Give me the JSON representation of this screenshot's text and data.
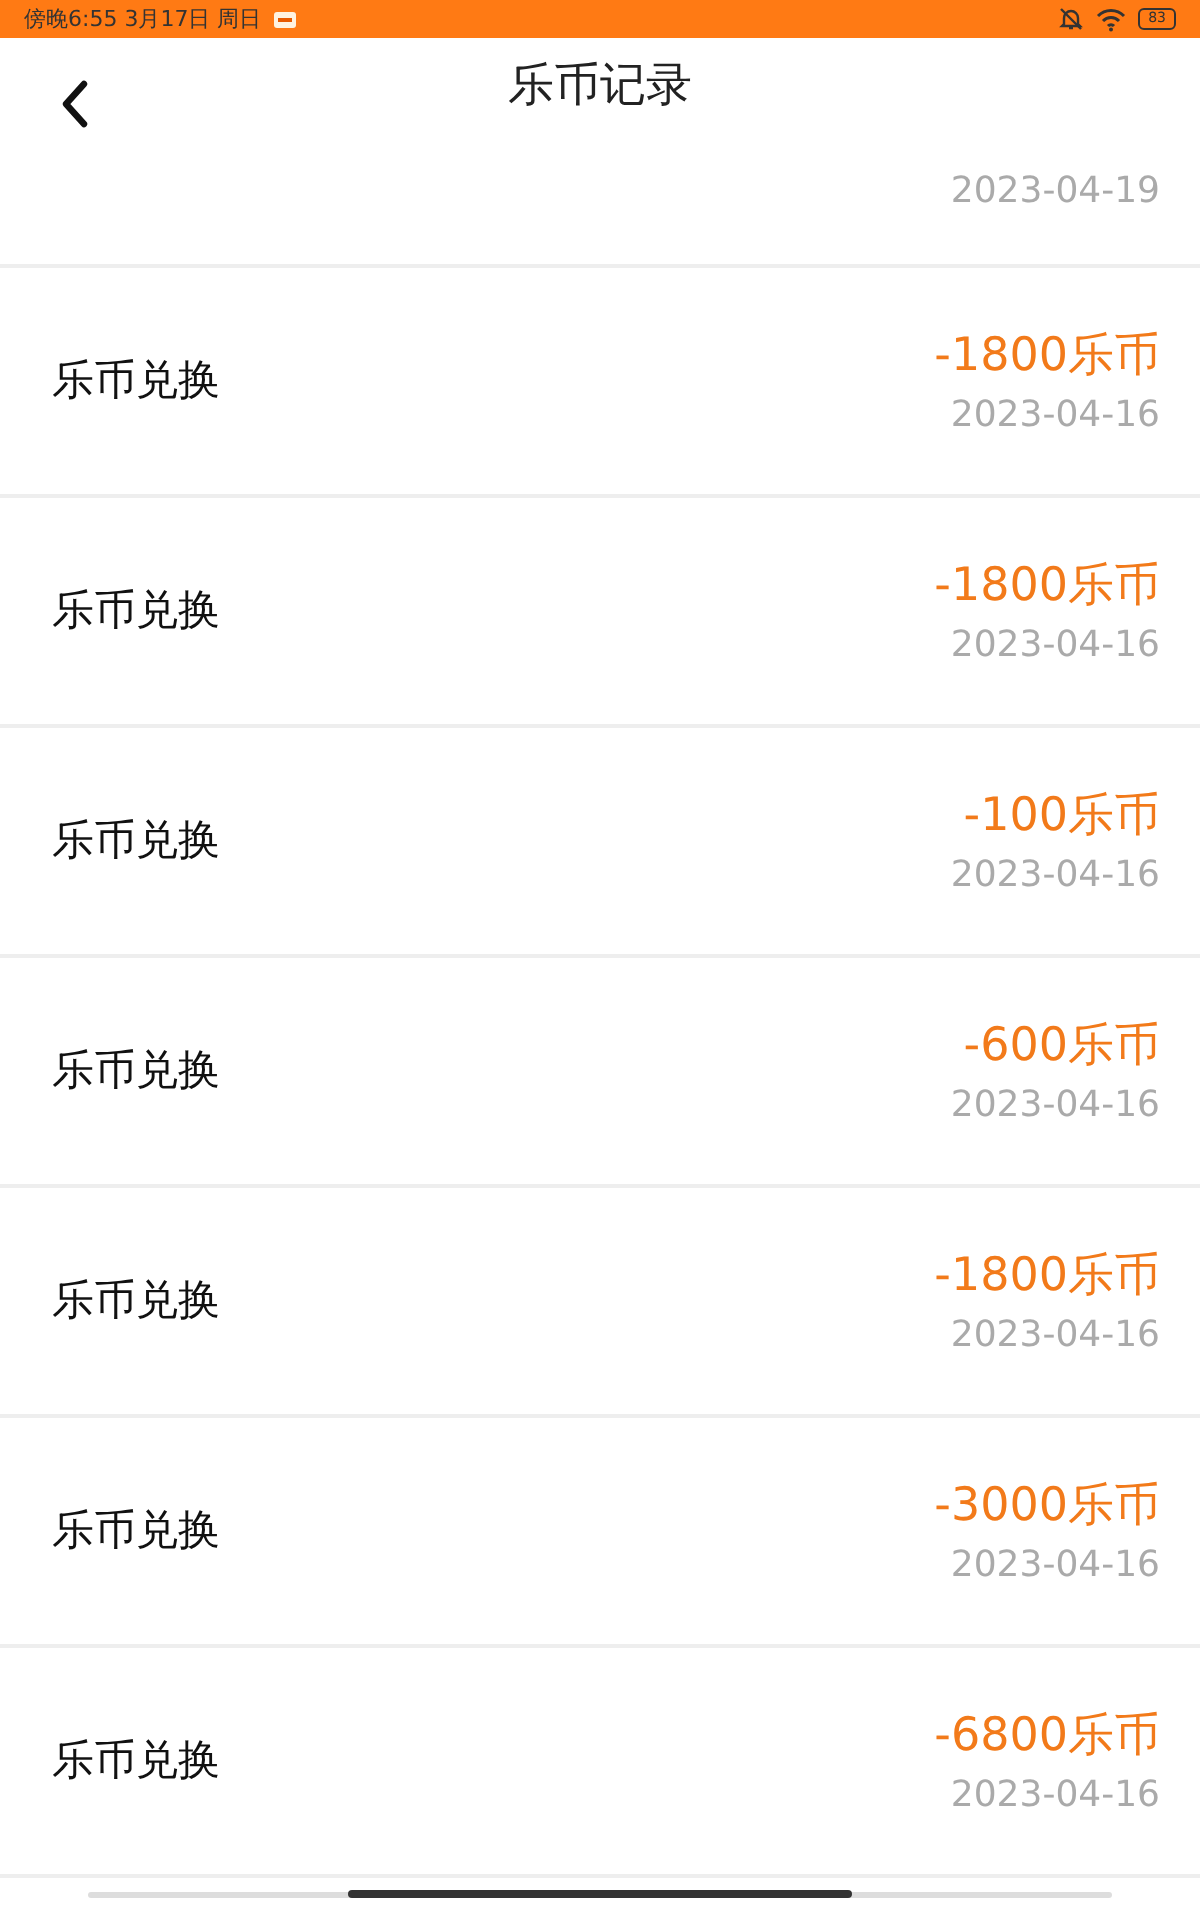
{
  "status_bar": {
    "time": "傍晚6:55 3月17日 周日",
    "battery": "83"
  },
  "header": {
    "title": "乐币记录"
  },
  "partial_record": {
    "date": "2023-04-19"
  },
  "records": [
    {
      "title": "乐币兑换",
      "amount": "-1800乐币",
      "date": "2023-04-16"
    },
    {
      "title": "乐币兑换",
      "amount": "-1800乐币",
      "date": "2023-04-16"
    },
    {
      "title": "乐币兑换",
      "amount": "-100乐币",
      "date": "2023-04-16"
    },
    {
      "title": "乐币兑换",
      "amount": "-600乐币",
      "date": "2023-04-16"
    },
    {
      "title": "乐币兑换",
      "amount": "-1800乐币",
      "date": "2023-04-16"
    },
    {
      "title": "乐币兑换",
      "amount": "-3000乐币",
      "date": "2023-04-16"
    },
    {
      "title": "乐币兑换",
      "amount": "-6800乐币",
      "date": "2023-04-16"
    }
  ]
}
